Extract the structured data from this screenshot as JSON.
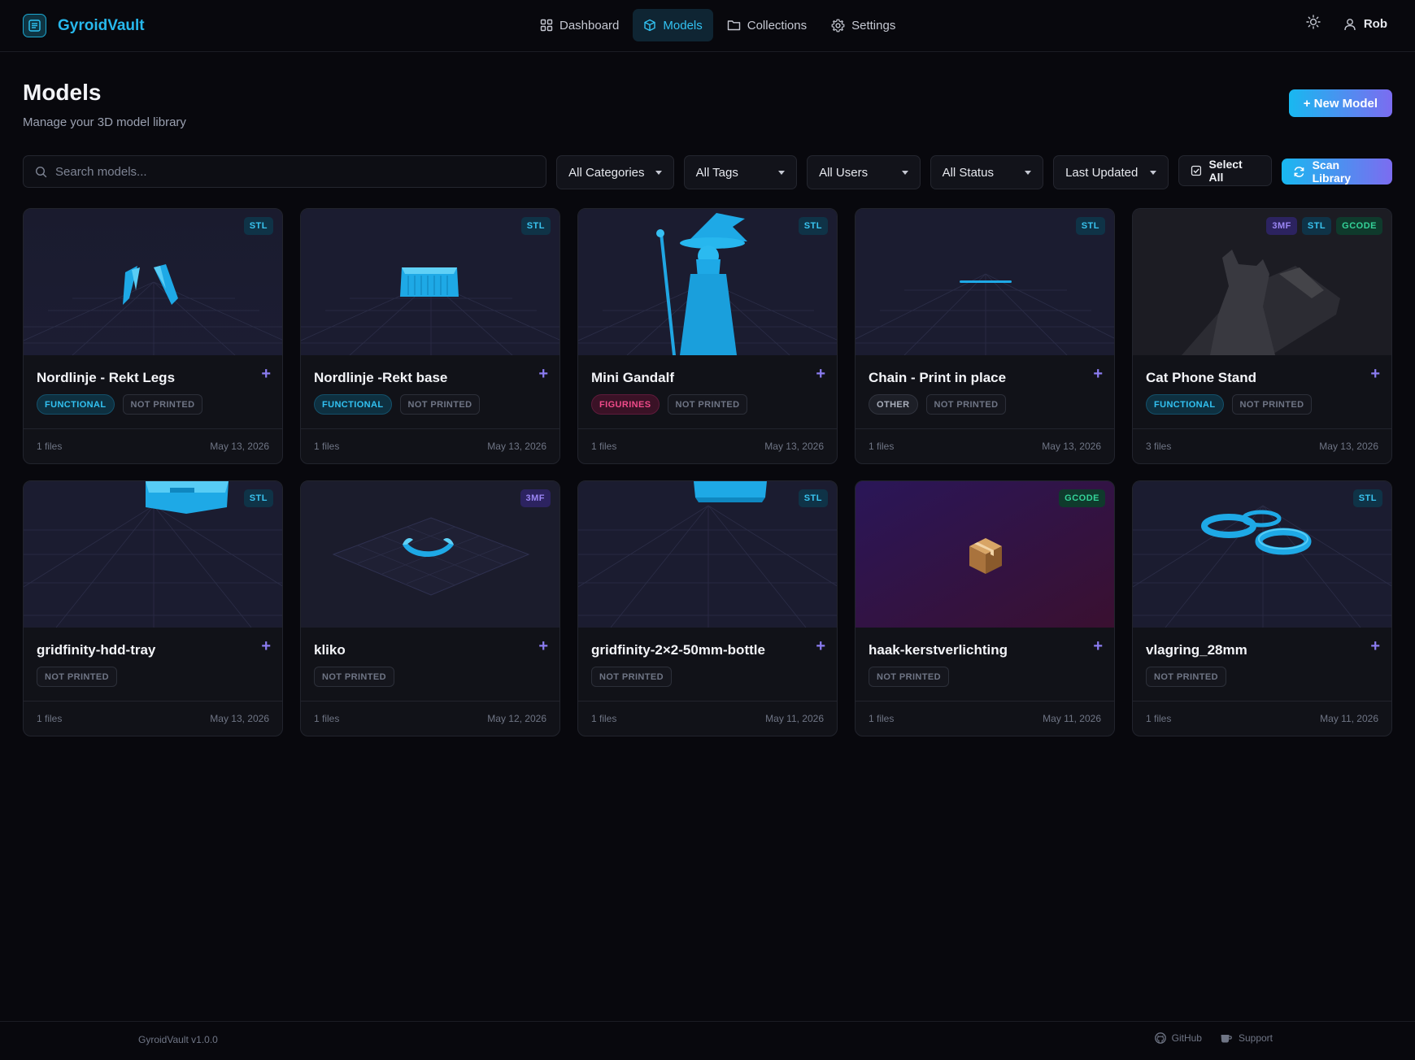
{
  "app": {
    "name": "GyroidVault"
  },
  "nav": [
    {
      "label": "Dashboard",
      "icon": "dashboard-grid-icon"
    },
    {
      "label": "Models",
      "icon": "cube-icon",
      "active": true
    },
    {
      "label": "Collections",
      "icon": "folder-icon"
    },
    {
      "label": "Settings",
      "icon": "gear-icon"
    }
  ],
  "user": {
    "name": "Rob"
  },
  "page": {
    "title": "Models",
    "subtitle": "Manage your 3D model library",
    "new_button": "+ New Model"
  },
  "filters": {
    "search_placeholder": "Search models...",
    "categories": "All Categories",
    "tags": "All Tags",
    "users": "All Users",
    "status": "All Status",
    "sort": "Last Updated",
    "select_all": "Select All",
    "scan": "Scan Library"
  },
  "models": [
    {
      "title": "Nordlinje - Rekt Legs",
      "formats": [
        "STL"
      ],
      "tags": [
        "FUNCTIONAL",
        "NOT PRINTED"
      ],
      "files": "1 files",
      "date": "May 13, 2026"
    },
    {
      "title": "Nordlinje -Rekt base",
      "formats": [
        "STL"
      ],
      "tags": [
        "FUNCTIONAL",
        "NOT PRINTED"
      ],
      "files": "1 files",
      "date": "May 13, 2026"
    },
    {
      "title": "Mini Gandalf",
      "formats": [
        "STL"
      ],
      "tags": [
        "FIGURINES",
        "NOT PRINTED"
      ],
      "files": "1 files",
      "date": "May 13, 2026"
    },
    {
      "title": "Chain - Print in place",
      "formats": [
        "STL"
      ],
      "tags": [
        "OTHER",
        "NOT PRINTED"
      ],
      "files": "1 files",
      "date": "May 13, 2026"
    },
    {
      "title": "Cat Phone Stand",
      "formats": [
        "3MF",
        "STL",
        "GCODE"
      ],
      "tags": [
        "FUNCTIONAL",
        "NOT PRINTED"
      ],
      "files": "3 files",
      "date": "May 13, 2026"
    },
    {
      "title": "gridfinity-hdd-tray",
      "formats": [
        "STL"
      ],
      "tags": [
        "NOT PRINTED"
      ],
      "files": "1 files",
      "date": "May 13, 2026"
    },
    {
      "title": "kliko",
      "formats": [
        "3MF"
      ],
      "tags": [
        "NOT PRINTED"
      ],
      "files": "1 files",
      "date": "May 12, 2026"
    },
    {
      "title": "gridfinity-2×2-50mm-bottle",
      "formats": [
        "STL"
      ],
      "tags": [
        "NOT PRINTED"
      ],
      "files": "1 files",
      "date": "May 11, 2026"
    },
    {
      "title": "haak-kerstverlichting",
      "formats": [
        "GCODE"
      ],
      "tags": [
        "NOT PRINTED"
      ],
      "files": "1 files",
      "date": "May 11, 2026"
    },
    {
      "title": "vlagring_28mm",
      "formats": [
        "STL"
      ],
      "tags": [
        "NOT PRINTED"
      ],
      "files": "1 files",
      "date": "May 11, 2026"
    }
  ],
  "footer": {
    "version": "GyroidVault v1.0.0",
    "github": "GitHub",
    "support": "Support"
  },
  "colors": {
    "accent": "#27b8ec",
    "accent_purple": "#7c6cf0",
    "background": "#08080d",
    "model_blue": "#1ea9e6"
  }
}
